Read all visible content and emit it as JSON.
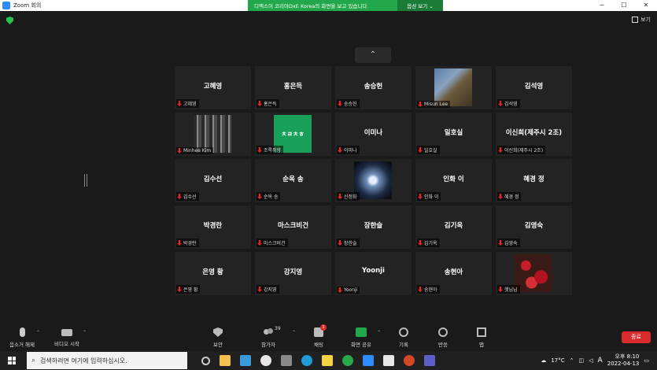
{
  "window": {
    "title": "Zoom 회의",
    "controls": [
      "─",
      "☐",
      "✕"
    ]
  },
  "share_banner": {
    "message": "디맥스이 코리아DxE Korea의 화면을 보고 있습니다",
    "options_label": "옵션 보기 ⌄"
  },
  "view_button": {
    "label": "보기"
  },
  "participants": [
    {
      "big": "고혜영",
      "name": "고혜영"
    },
    {
      "big": "홍은득",
      "name": "홍은득"
    },
    {
      "big": "송승헌",
      "name": "송승헌"
    },
    {
      "big": "",
      "name": "Misun Lee",
      "photo": "cliff"
    },
    {
      "big": "김석영",
      "name": "김석영"
    },
    {
      "big": "",
      "name": "Minhee Kim",
      "photo": "forest"
    },
    {
      "big": "",
      "name": "조록취향",
      "photo": "green",
      "photo_text": "ㅊㄹㅊㅎ"
    },
    {
      "big": "이미나",
      "name": "이미나"
    },
    {
      "big": "일호실",
      "name": "일호실"
    },
    {
      "big": "이신희(제주시 2조)",
      "name": "이신희(제주시 2조)"
    },
    {
      "big": "김수선",
      "name": "김수선"
    },
    {
      "big": "순옥 송",
      "name": "순옥 송"
    },
    {
      "big": "",
      "name": "신정화",
      "photo": "space"
    },
    {
      "big": "인화 이",
      "name": "인화 이"
    },
    {
      "big": "혜경 정",
      "name": "혜경 정"
    },
    {
      "big": "박경란",
      "name": "박경란"
    },
    {
      "big": "마스크비건",
      "name": "마스크비건"
    },
    {
      "big": "장한슬",
      "name": "장한슬"
    },
    {
      "big": "김기옥",
      "name": "김기옥"
    },
    {
      "big": "김영숙",
      "name": "김영숙"
    },
    {
      "big": "은영 황",
      "name": "은영 황"
    },
    {
      "big": "강지영",
      "name": "강지영"
    },
    {
      "big": "Yoonji",
      "name": "Yoonji"
    },
    {
      "big": "송현아",
      "name": "송현아"
    },
    {
      "big": "",
      "name": "햇님님",
      "photo": "flowers"
    }
  ],
  "toolbar": {
    "unmute": "음소거 해제",
    "start_video": "비디오 시작",
    "security": "보안",
    "participants": "참가자",
    "participants_count": "39",
    "chat": "채팅",
    "chat_badge": "1",
    "share_screen": "화면 공유",
    "record": "기록",
    "reactions": "반응",
    "apps": "앱",
    "end": "종료"
  },
  "taskbar": {
    "search_placeholder": "검색하려면 여기에 입력하십시오.",
    "weather": "17°C",
    "time": "오후 8:10",
    "date": "2022-04-13",
    "ime": "A"
  },
  "colors": {
    "accent_green": "#22a74a",
    "end_red": "#d92b2b",
    "muted_red": "#e02828"
  }
}
